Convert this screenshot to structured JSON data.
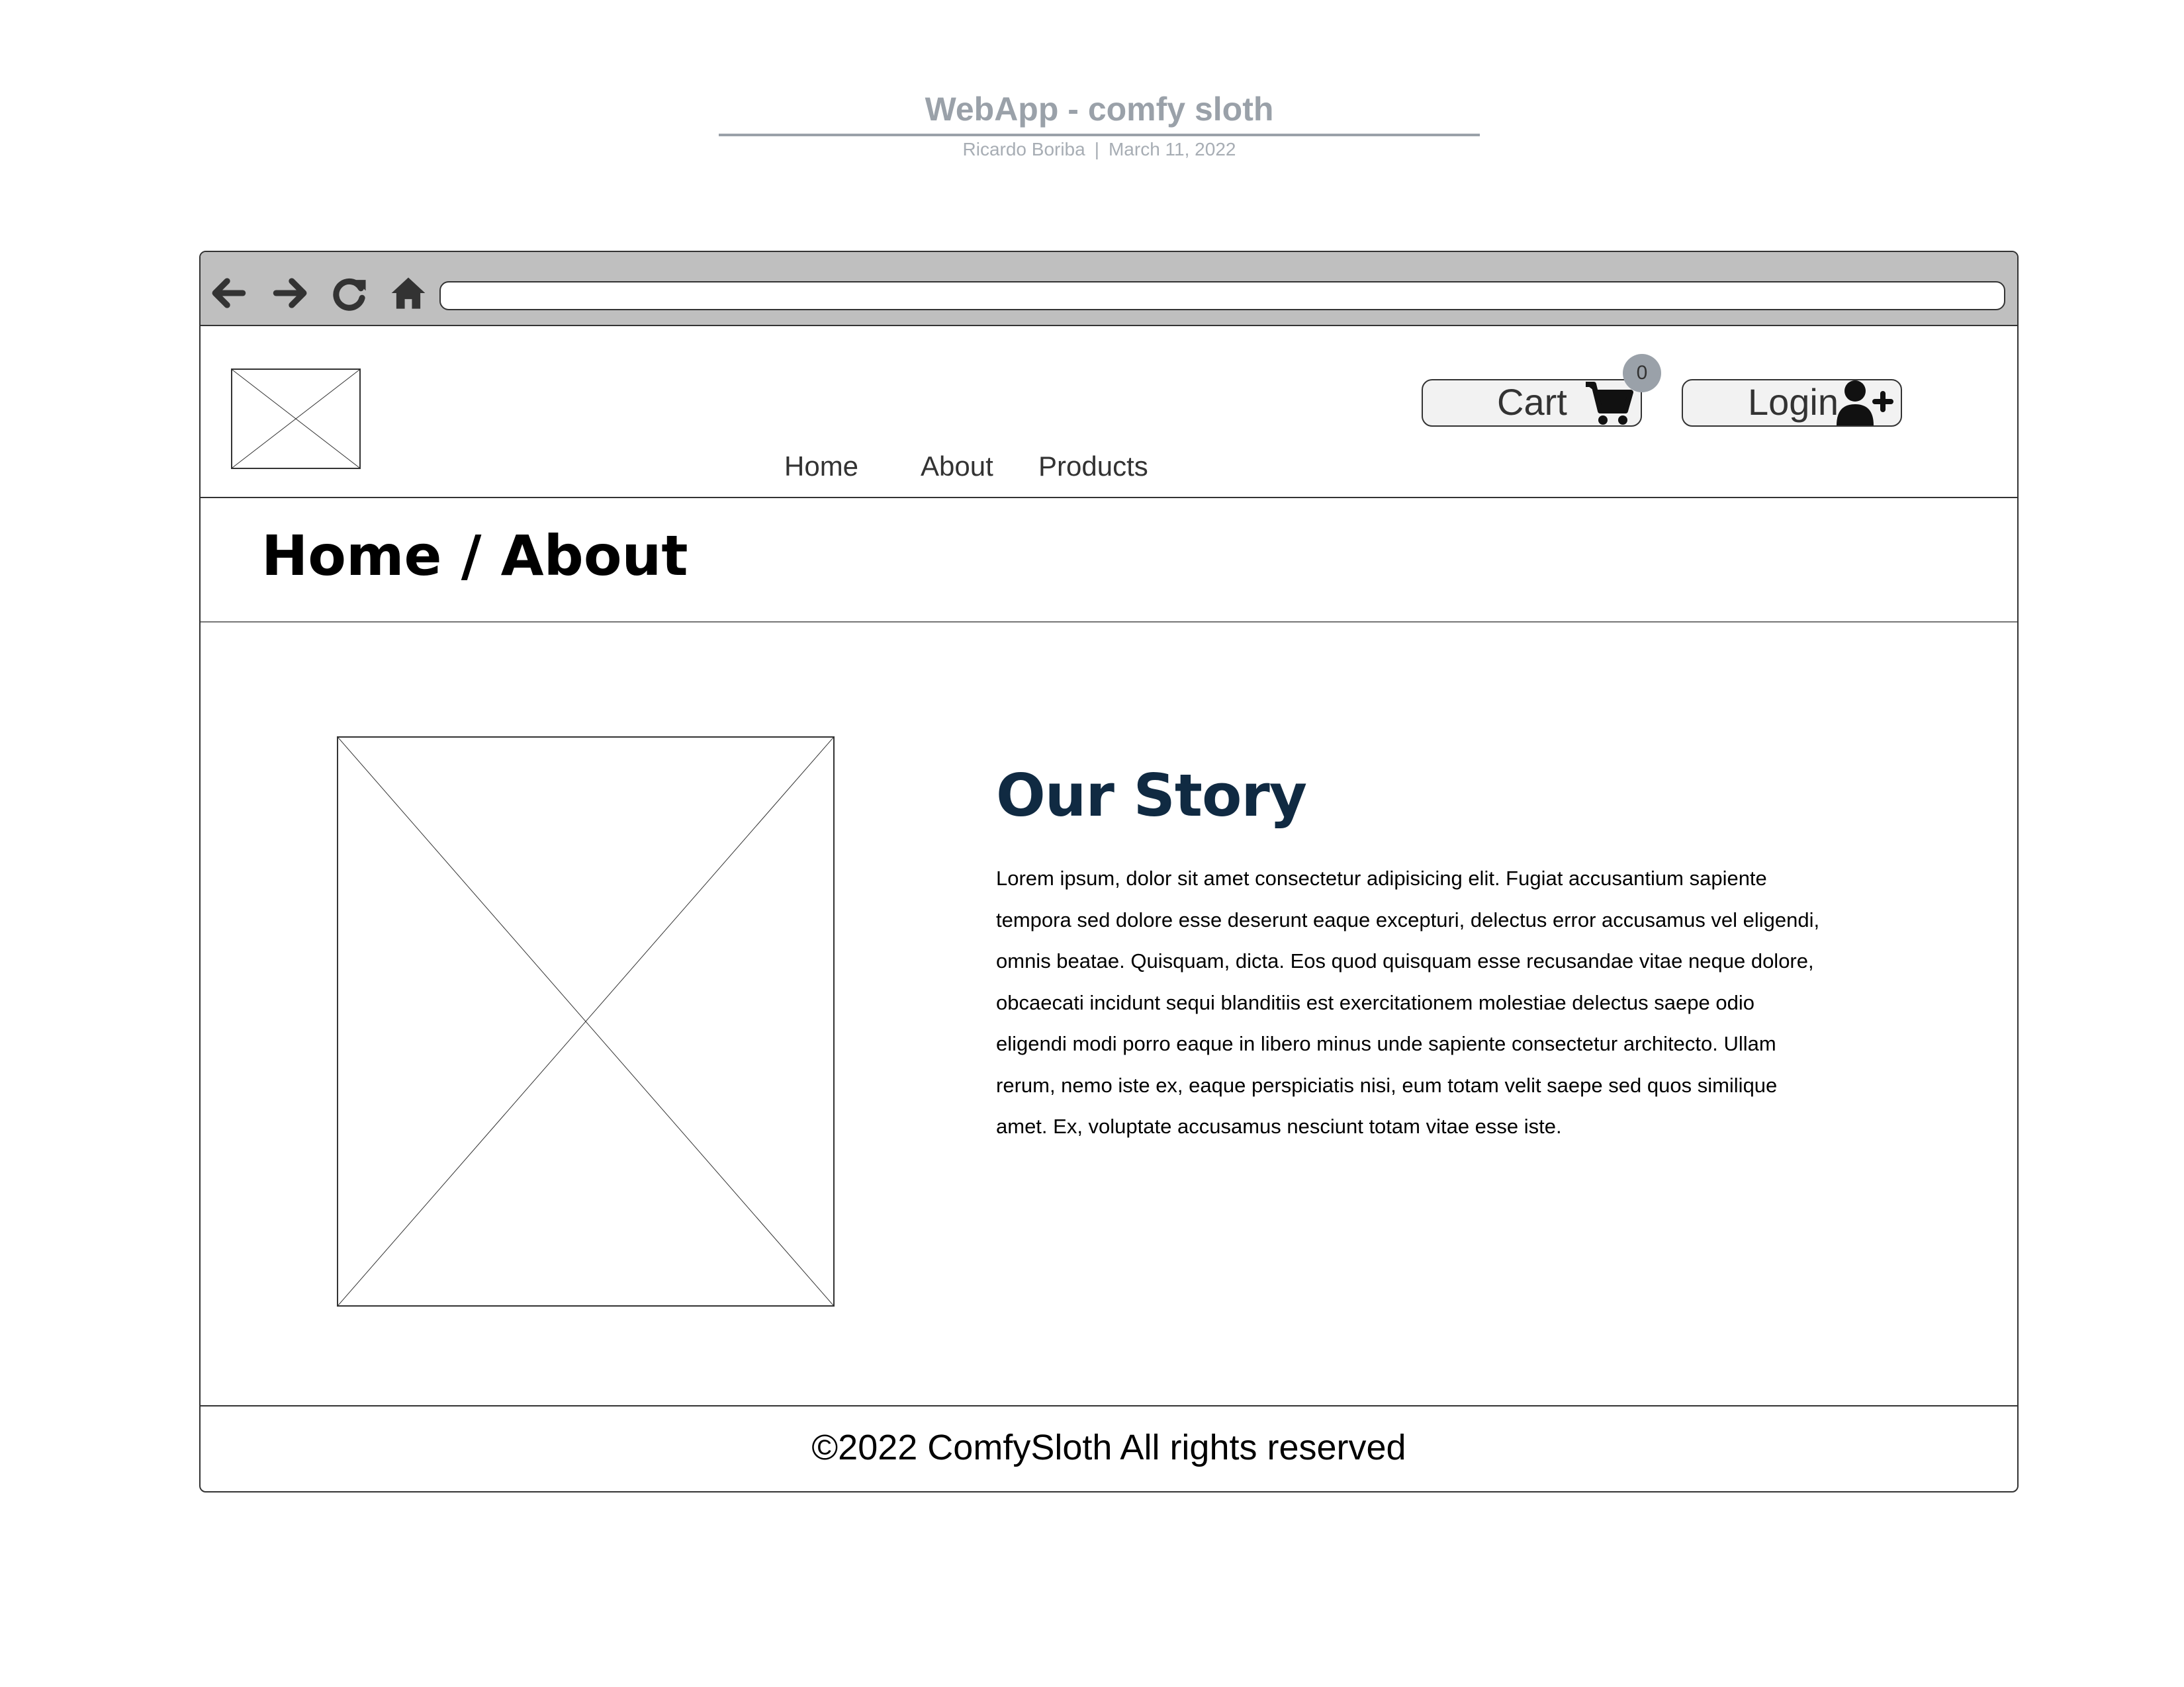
{
  "document": {
    "title": "WebApp - comfy sloth",
    "author": "Ricardo Boriba",
    "separator": "|",
    "date": "March 11, 2022"
  },
  "browser": {
    "back_icon": "arrow-left-icon",
    "forward_icon": "arrow-right-icon",
    "reload_icon": "reload-icon",
    "home_icon": "home-icon",
    "address_value": ""
  },
  "nav": {
    "links": [
      "Home",
      "About",
      "Products"
    ],
    "cart_label": "Cart",
    "cart_count": "0",
    "login_label": "Login"
  },
  "breadcrumb": "Home / About",
  "story": {
    "heading": "Our Story",
    "body": "Lorem ipsum, dolor sit amet consectetur adipisicing elit. Fugiat accusantium sapiente tempora sed dolore esse deserunt eaque excepturi, delectus error accusamus vel eligendi, omnis beatae. Quisquam, dicta. Eos quod quisquam esse recusandae vitae neque dolore, obcaecati incidunt sequi blanditiis est exercitationem molestiae delectus saepe odio eligendi modi porro eaque in libero minus unde sapiente consectetur architecto. Ullam rerum, nemo iste ex, eaque perspiciatis nisi, eum totam velit saepe sed quos similique amet. Ex, voluptate accusamus nesciunt totam vitae esse iste."
  },
  "footer": {
    "text": "©2022 ComfySloth All rights reserved"
  },
  "colors": {
    "heading": "#102a42",
    "muted": "#9aa1a9",
    "browser_bar": "#bfbfbf"
  }
}
